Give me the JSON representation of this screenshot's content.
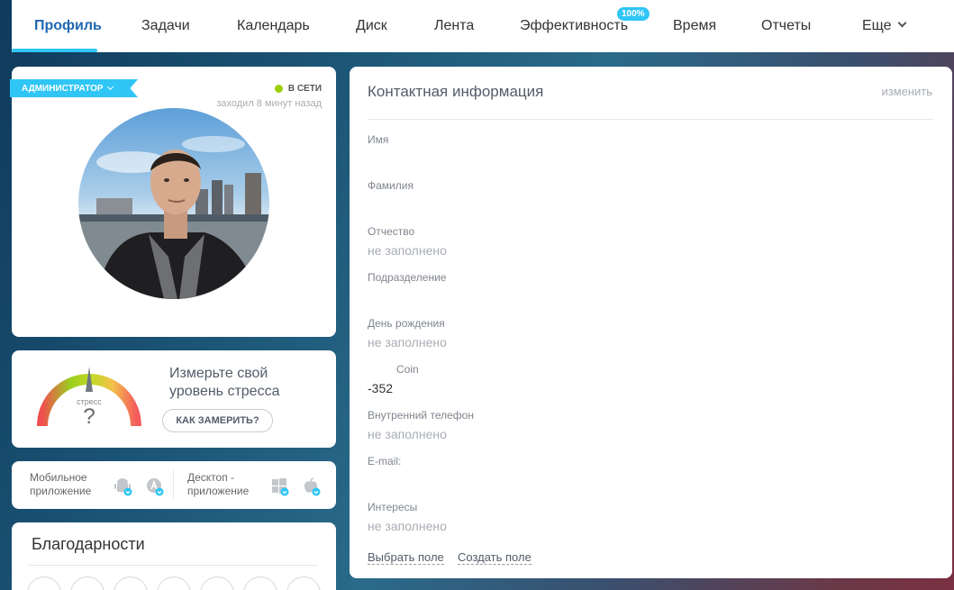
{
  "nav": {
    "tabs": [
      {
        "label": "Профиль",
        "active": true
      },
      {
        "label": "Задачи"
      },
      {
        "label": "Календарь"
      },
      {
        "label": "Диск"
      },
      {
        "label": "Лента"
      },
      {
        "label": "Эффективность",
        "badge": "100%"
      },
      {
        "label": "Время"
      },
      {
        "label": "Отчеты"
      },
      {
        "label": "Еще"
      }
    ]
  },
  "profile": {
    "role": "АДМИНИСТРАТОР",
    "status": "В СЕТИ",
    "last_seen": "заходил 8 минут назад"
  },
  "stress": {
    "gauge_label": "стресс",
    "gauge_value": "?",
    "text": "Измерьте свой уровень стресса",
    "button": "КАК ЗАМЕРИТЬ?"
  },
  "apps": {
    "mobile_label": "Мобильное приложение",
    "desktop_label": "Десктоп - приложение",
    "icons": [
      "android-icon",
      "apple-store-icon",
      "windows-icon",
      "apple-icon"
    ]
  },
  "thanks": {
    "title": "Благодарности",
    "icons": [
      "cup-icon",
      "gift-icon",
      "money-icon",
      "hourglass-icon",
      "crown-icon",
      "check-icon",
      "more-icon"
    ]
  },
  "contact": {
    "title": "Контактная информация",
    "edit": "изменить",
    "fields": [
      {
        "label": "Имя",
        "value": ""
      },
      {
        "label": "Фамилия",
        "value": ""
      },
      {
        "label": "Отчество",
        "value": "не заполнено"
      },
      {
        "label": "Подразделение",
        "value": ""
      },
      {
        "label": "День рождения",
        "value": "не заполнено"
      },
      {
        "label": "Coin",
        "value": "-352"
      },
      {
        "label": "Внутренний телефон",
        "value": "не заполнено"
      },
      {
        "label": "E-mail:",
        "value": ""
      },
      {
        "label": "Интересы",
        "value": "не заполнено"
      }
    ],
    "select_field": "Выбрать поле",
    "create_field": "Создать поле"
  },
  "colors": {
    "accent": "#2fc6f6",
    "active_tab": "#2067b0",
    "online": "#9dcf00"
  }
}
